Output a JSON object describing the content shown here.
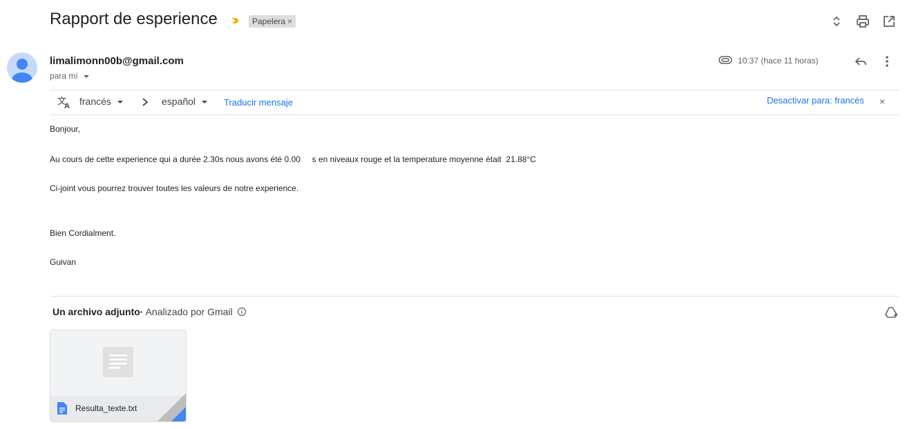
{
  "header": {
    "subject": "Rapport de esperience",
    "label_chip": "Papelera",
    "label_chip_close": "×"
  },
  "message": {
    "sender": "limalimonn00b@gmail.com",
    "to": "para mí",
    "time": "10:37 (hace 11 horas)"
  },
  "translate": {
    "from_lang": "francés",
    "to_lang": "español",
    "translate_link": "Traducir mensaje",
    "disable_link": "Desactivar para: francés",
    "close": "×"
  },
  "body": {
    "greeting": "Bonjour,",
    "line1": "Au cours de cette experience qui a durée 2.30s nous avons été 0.00     s en niveaux rouge et la temperature moyenne était  21.88°C",
    "line2": "Ci-joint vous pourrez trouver toutes les valeurs de notre experience.",
    "closing": "Bien Cordialment.",
    "signature": "Guivan"
  },
  "attachments": {
    "title": "Un archivo adjunto",
    "separator": "·",
    "scanned": "Analizado por Gmail",
    "file_name": "Resulta_texte.txt"
  },
  "colors": {
    "accent": "#1a73e8",
    "importance": "#f4b400",
    "avatar_bg": "#c6dafc",
    "avatar_fg": "#4285f4"
  }
}
